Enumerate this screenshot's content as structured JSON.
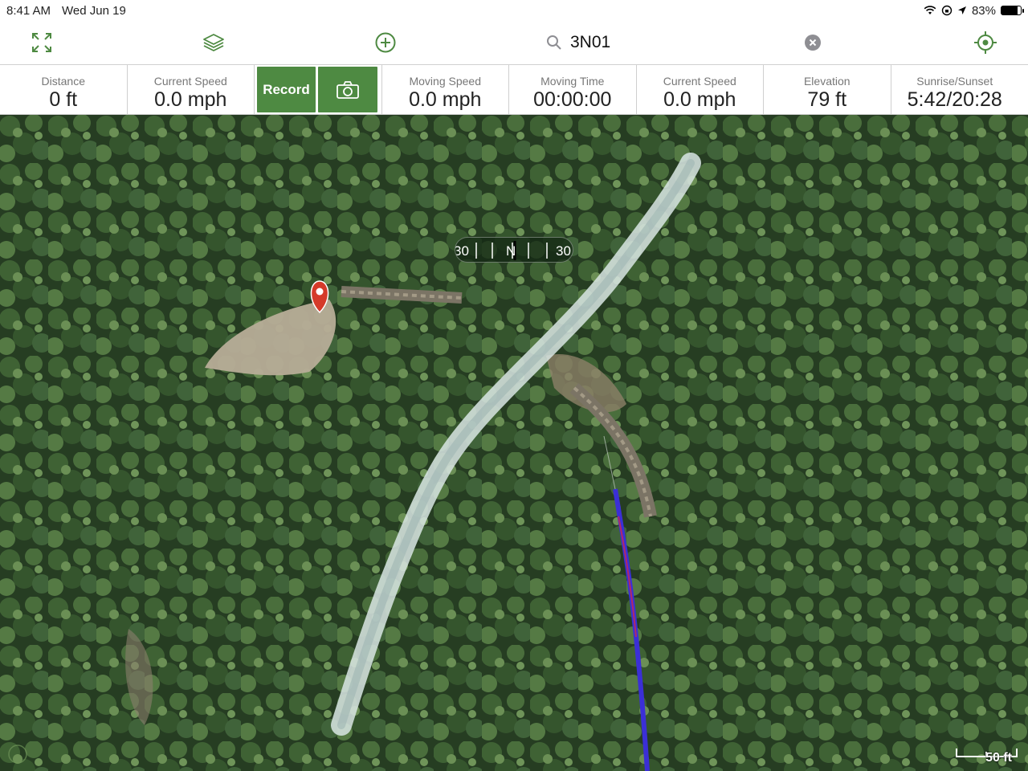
{
  "status_bar": {
    "time": "8:41 AM",
    "date": "Wed Jun 19",
    "battery": "83%",
    "battery_level": 0.83
  },
  "toolbar": {
    "search_value": "3N01",
    "icons": [
      "expand-icon",
      "layers-icon",
      "add-icon",
      "search-icon",
      "clear-icon",
      "locate-icon"
    ],
    "accent_color": "#4e8a42"
  },
  "stats": {
    "distance": {
      "label": "Distance",
      "value": "0 ft"
    },
    "current_speed_1": {
      "label": "Current Speed",
      "value": "0.0 mph"
    },
    "record_label": "Record",
    "moving_speed": {
      "label": "Moving Speed",
      "value": "0.0 mph"
    },
    "moving_time": {
      "label": "Moving Time",
      "value": "00:00:00"
    },
    "current_speed_2": {
      "label": "Current Speed",
      "value": "0.0 mph"
    },
    "elevation": {
      "label": "Elevation",
      "value": "79 ft"
    },
    "sunrise_sunset": {
      "label": "Sunrise/Sunset",
      "value": "5:42/20:28"
    }
  },
  "map": {
    "compass_left": "30",
    "compass_center": "N",
    "compass_right": "30",
    "scale_label": "50 ft",
    "track_color": "#3b2fd6",
    "marker_color": "#d53a2a"
  }
}
